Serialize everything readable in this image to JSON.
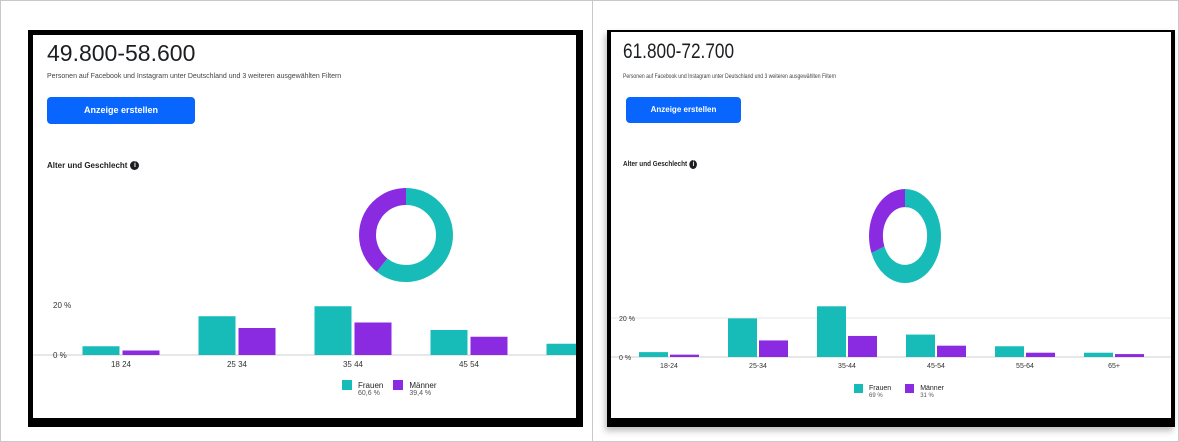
{
  "panels": [
    {
      "range": "49.800-58.600",
      "subtitle": "Personen auf Facebook und Instagram unter Deutschland und 3 weiteren ausgewählten Filtern",
      "button_label": "Anzeige erstellen",
      "section_title": "Alter und Geschlecht",
      "info_icon": "info-icon"
    },
    {
      "range": "61.800-72.700",
      "subtitle": "Personen auf Facebook und Instagram unter Deutschland und 3 weiteren ausgewählten Filtern",
      "button_label": "Anzeige erstellen",
      "section_title": "Alter und Geschlecht",
      "info_icon": "info-icon"
    }
  ],
  "colors": {
    "frauen": "#17bcb8",
    "maenner": "#8a2be2",
    "button": "#0866ff"
  },
  "chart_data": [
    {
      "type": "bar",
      "categories": [
        "18 24",
        "25 34",
        "35 44",
        "45 54",
        ""
      ],
      "series": [
        {
          "name": "Frauen",
          "values": [
            3.5,
            15.5,
            19.5,
            10,
            4.5
          ]
        },
        {
          "name": "Männer",
          "values": [
            1.8,
            10.8,
            13,
            7.3,
            0
          ]
        }
      ],
      "ylim": [
        0,
        20
      ],
      "yticks": [
        "0 %",
        "20 %"
      ],
      "grid": false,
      "legend_position": "bottom-right",
      "donut": {
        "type": "pie",
        "labels": [
          "Frauen",
          "Männer"
        ],
        "values": [
          60.6,
          39.4
        ]
      },
      "legend": [
        {
          "label": "Frauen",
          "pct": "60,6 %"
        },
        {
          "label": "Männer",
          "pct": "39,4 %"
        }
      ]
    },
    {
      "type": "bar",
      "categories": [
        "18-24",
        "25-34",
        "35-44",
        "45-54",
        "55-64",
        "65+"
      ],
      "series": [
        {
          "name": "Frauen",
          "values": [
            2.5,
            19.8,
            26,
            11.5,
            5.5,
            2.2
          ]
        },
        {
          "name": "Männer",
          "values": [
            1.2,
            8.5,
            10.8,
            5.8,
            2.2,
            1.5
          ]
        }
      ],
      "ylim": [
        0,
        20
      ],
      "yticks": [
        "0 %",
        "20 %"
      ],
      "grid": true,
      "legend_position": "bottom-right",
      "donut": {
        "type": "pie",
        "labels": [
          "Frauen",
          "Männer"
        ],
        "values": [
          69,
          31
        ]
      },
      "legend": [
        {
          "label": "Frauen",
          "pct": "69 %"
        },
        {
          "label": "Männer",
          "pct": "31 %"
        }
      ]
    }
  ]
}
